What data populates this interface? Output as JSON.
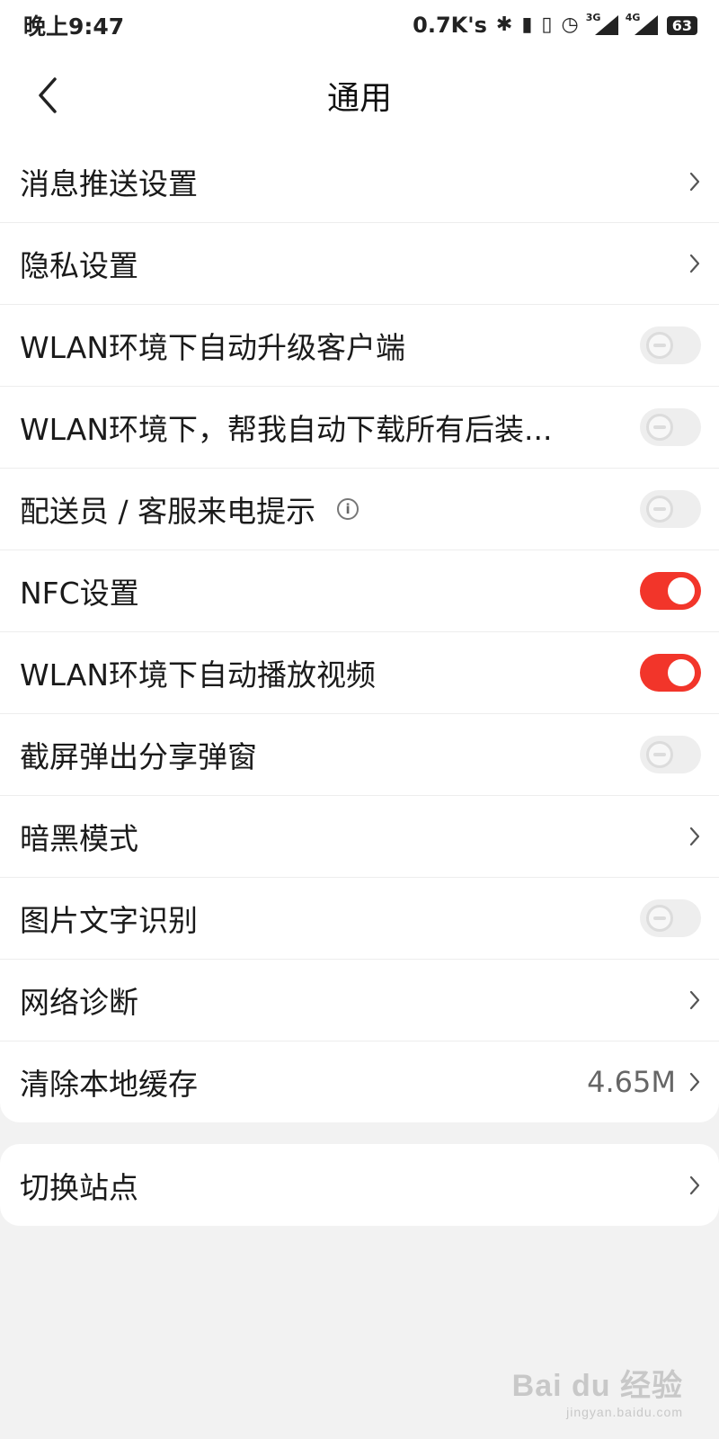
{
  "status_bar": {
    "time": "晚上9:47",
    "net_speed": "0.7K's",
    "signal_3g": "3G",
    "signal_4g": "4G",
    "battery": "63",
    "icons": [
      "bluetooth-icon",
      "battery-saver-icon",
      "vibrate-icon",
      "alarm-icon",
      "signal-3g-icon",
      "signal-4g-icon",
      "battery-icon"
    ]
  },
  "header": {
    "title": "通用"
  },
  "settings": [
    {
      "label": "消息推送设置",
      "control": "chevron"
    },
    {
      "label": "隐私设置",
      "control": "chevron"
    },
    {
      "label": "WLAN环境下自动升级客户端",
      "control": "toggle",
      "on": false
    },
    {
      "label": "WLAN环境下，帮我自动下载所有后装...",
      "control": "toggle",
      "on": false
    },
    {
      "label": "配送员 / 客服来电提示",
      "control": "toggle",
      "on": false,
      "info": "i"
    },
    {
      "label": "NFC设置",
      "control": "toggle",
      "on": true
    },
    {
      "label": "WLAN环境下自动播放视频",
      "control": "toggle",
      "on": true
    },
    {
      "label": "截屏弹出分享弹窗",
      "control": "toggle",
      "on": false
    },
    {
      "label": "暗黑模式",
      "control": "chevron"
    },
    {
      "label": "图片文字识别",
      "control": "toggle",
      "on": false
    },
    {
      "label": "网络诊断",
      "control": "chevron"
    },
    {
      "label": "清除本地缓存",
      "control": "chevron",
      "value": "4.65M"
    }
  ],
  "site_switch": {
    "label": "切换站点"
  },
  "watermark": {
    "main": "Bai du 经验",
    "sub": "jingyan.baidu.com"
  },
  "colors": {
    "accent": "#f2352a",
    "background": "#f2f2f2",
    "card": "#ffffff"
  }
}
